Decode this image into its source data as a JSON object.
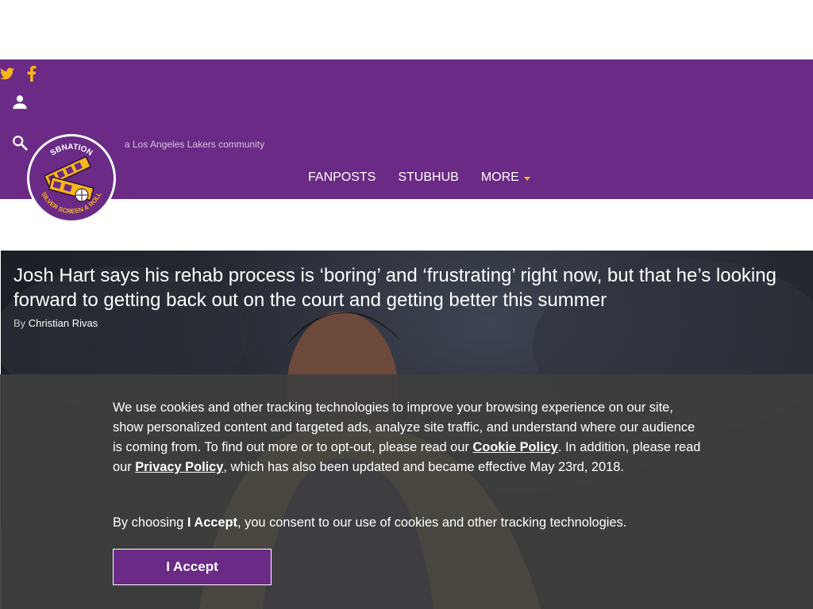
{
  "site": {
    "tagline": "a Los Angeles Lakers community",
    "brand_color": "#6a2a85",
    "accent_color": "#f7b619"
  },
  "nav": [
    {
      "label": "FANPOSTS"
    },
    {
      "label": "STUBHUB"
    },
    {
      "label": "MORE",
      "icon": "caret-down-icon"
    }
  ],
  "icons": [
    "twitter-icon",
    "facebook-icon",
    "user-icon",
    "search-icon"
  ],
  "logo": {
    "top_text": "SBNATION",
    "bottom_text": "SILVER SCREEN & ROLL"
  },
  "article": {
    "title": "Josh Hart says his rehab process is ‘boring’ and ‘frustrating’ right now, but that he’s looking forward to getting back out on the court and getting better this summer",
    "by": "By",
    "author": "Christian Rivas"
  },
  "cookie": {
    "p1_a": "We use cookies and other tracking technologies to improve your browsing experience on our site, show personalized content and targeted ads, analyze site traffic, and understand where our audience is coming from. To find out more or to opt-out, please read our ",
    "cookie_policy": "Cookie Policy",
    "p1_b": ". In addition, please read our ",
    "privacy_policy": "Privacy Policy",
    "p1_c": ", which has also been updated and became effective May 23rd, 2018.",
    "p2_a": "By choosing ",
    "p2_accept": "I Accept",
    "p2_b": ", you consent to our use of cookies and other tracking technologies.",
    "button": "I Accept"
  }
}
